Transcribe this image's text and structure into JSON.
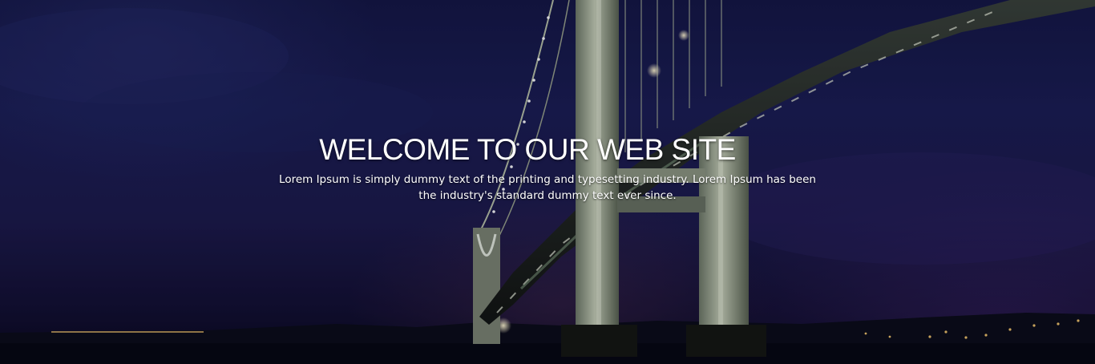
{
  "hero": {
    "title": "WELCOME TO OUR WEB SITE",
    "subtitle": "Lorem Ipsum is simply dummy text of the printing and typesetting industry. Lorem Ipsum has been the industry's standard dummy text ever since.",
    "background_image": "night-suspension-bridge-icon"
  },
  "colors": {
    "sky_top": "#141744",
    "sky_mid": "#1c1a4a",
    "bridge_light": "#c9d2b8",
    "text": "#ffffff"
  }
}
